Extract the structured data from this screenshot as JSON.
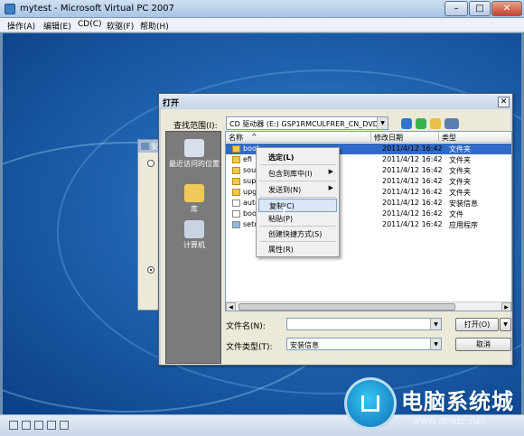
{
  "host": {
    "title": "mytest - Microsoft Virtual PC 2007",
    "menu": [
      "操作(A)",
      "编辑(E)",
      "CD(C)",
      "软驱(F)",
      "帮助(H)"
    ],
    "buttons": {
      "minimize": "–",
      "maximize": "□",
      "close": "✕"
    }
  },
  "setup_window": {
    "title": "安"
  },
  "dialog": {
    "title": "打开",
    "close_label": "✕",
    "look_in_label": "查找范围(I):",
    "look_in_value": "CD 驱动器 (E:) GSP1RMCULFRER_CN_DVD",
    "places": [
      {
        "label": "最近访问的位置",
        "icon": "recent-places-icon"
      },
      {
        "label": "库",
        "icon": "libraries-icon"
      },
      {
        "label": "计算机",
        "icon": "computer-icon"
      }
    ],
    "columns": [
      "名称",
      "修改日期",
      "类型"
    ],
    "sort_indicator": "^",
    "files": [
      {
        "name": "boot",
        "date": "2011/4/12 16:42",
        "type": "文件夹",
        "kind": "folder",
        "selected": true
      },
      {
        "name": "efi",
        "date": "2011/4/12 16:42",
        "type": "文件夹",
        "kind": "folder",
        "selected": false
      },
      {
        "name": "sourc",
        "date": "2011/4/12 16:42",
        "type": "文件夹",
        "kind": "folder",
        "selected": false
      },
      {
        "name": "suppo",
        "date": "2011/4/12 16:42",
        "type": "文件夹",
        "kind": "folder",
        "selected": false
      },
      {
        "name": "upgra",
        "date": "2011/4/12 16:42",
        "type": "文件夹",
        "kind": "folder",
        "selected": false
      },
      {
        "name": "autor",
        "date": "2011/4/12 16:42",
        "type": "安装信息",
        "kind": "file",
        "selected": false
      },
      {
        "name": "bootm",
        "date": "2011/4/12 16:42",
        "type": "文件",
        "kind": "file",
        "selected": false
      },
      {
        "name": "setup",
        "date": "2011/4/12 16:42",
        "type": "应用程序",
        "kind": "file",
        "selected": false
      }
    ],
    "filename_label": "文件名(N):",
    "filename_value": "",
    "filetype_label": "文件类型(T):",
    "filetype_value": "安装信息",
    "open_button": "打开(O)",
    "cancel_button": "取消"
  },
  "context_menu": {
    "items": [
      {
        "label": "选定(L)",
        "bold": true
      },
      {
        "label": "包含到库中(I)",
        "submenu": true
      },
      {
        "label": "发送到(N)",
        "submenu": true
      },
      {
        "label": "复制(C)",
        "highlighted": true
      },
      {
        "label": "粘贴(P)"
      },
      {
        "label": "创建快捷方式(S)"
      },
      {
        "label": "属性(R)"
      }
    ],
    "submenu_arrow": "▶"
  },
  "watermark": {
    "title": "电脑系统城",
    "url": "www.dnxtc.net"
  }
}
